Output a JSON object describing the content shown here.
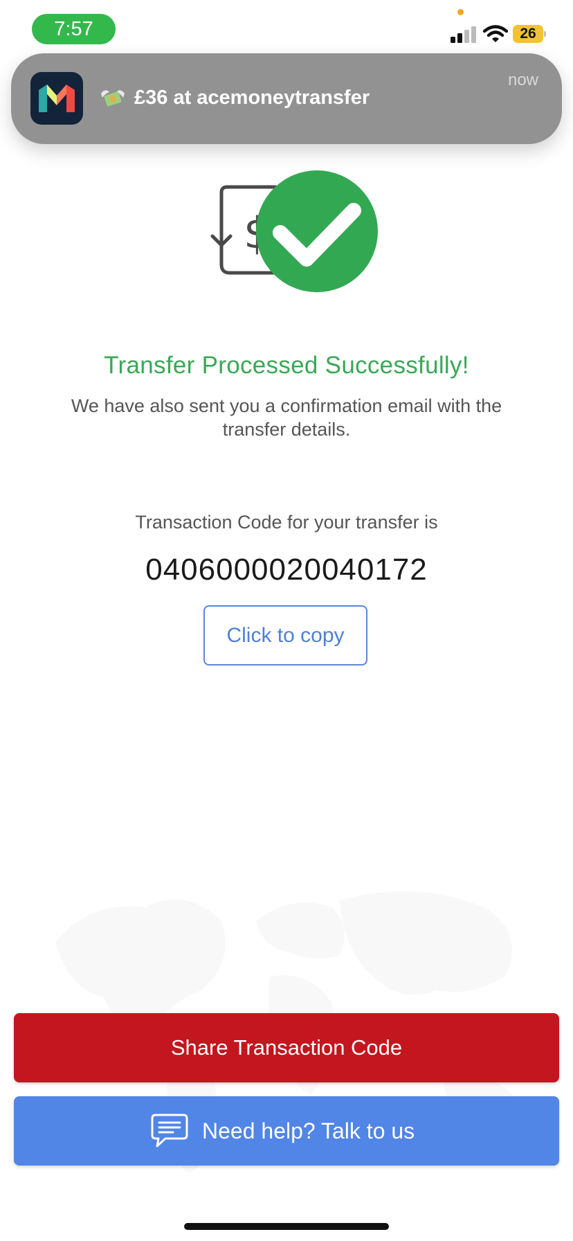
{
  "status_bar": {
    "time": "7:57",
    "battery_level": "26",
    "pill_color": "#33b84c",
    "battery_color": "#f2c230"
  },
  "notification": {
    "app_icon": "monzo-app-icon",
    "emoji_icon": "money-with-wings-icon",
    "text": "£36 at acemoneytransfer",
    "time": "now"
  },
  "success": {
    "icon": "transfer-success-icon",
    "title": "Transfer Processed Successfully!",
    "message": "We have also sent you a confirmation email with the transfer details.",
    "title_color": "#3aa856"
  },
  "transaction": {
    "code_label": "Transaction Code for your transfer is",
    "code": "0406000020040172",
    "copy_label": "Click to copy"
  },
  "actions": {
    "share_label": "Share Transaction Code",
    "share_color": "#c4161e",
    "help_label": "Need help? Talk to us",
    "help_color": "#5185e6",
    "help_icon": "chat-icon"
  }
}
